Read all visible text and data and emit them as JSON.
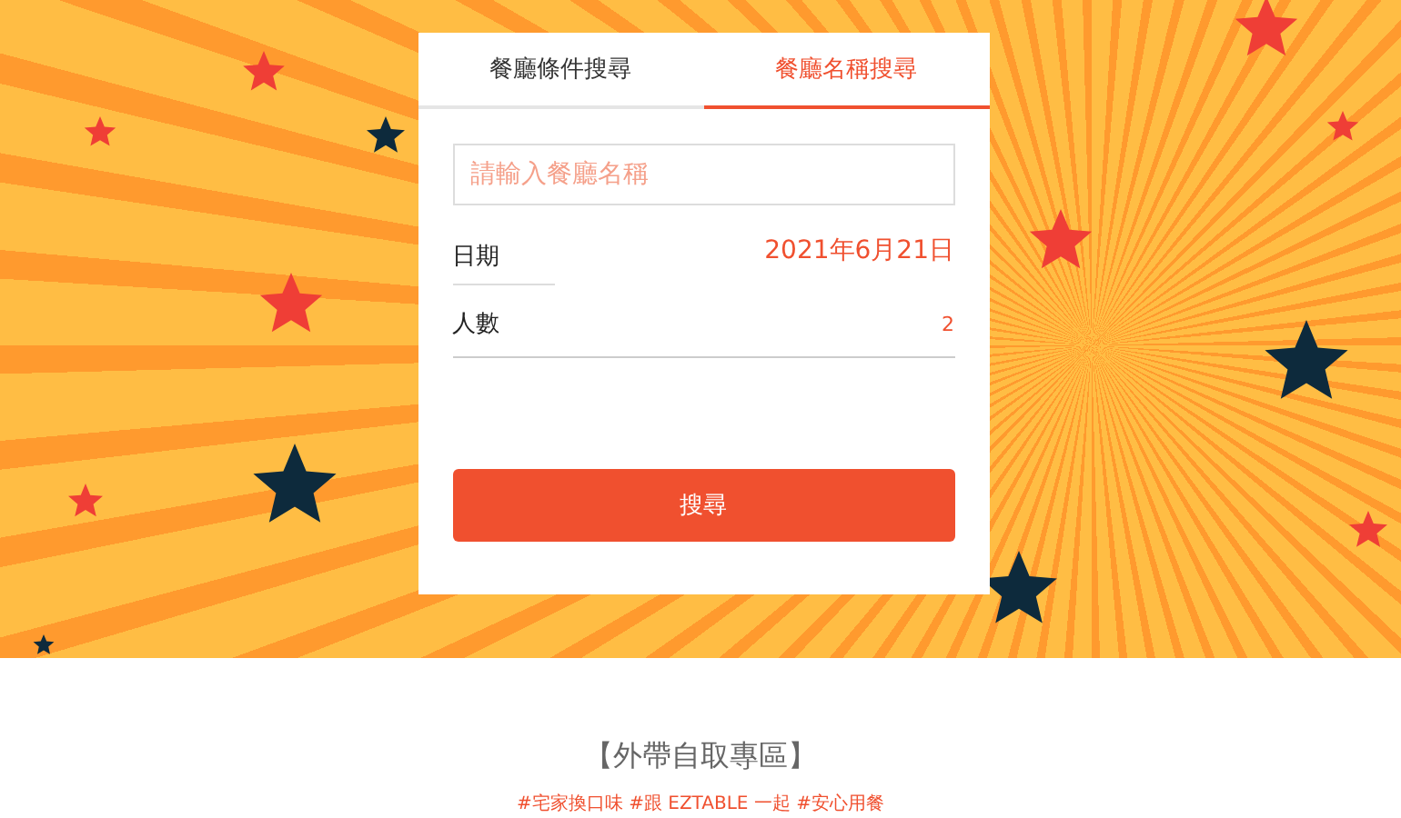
{
  "search_card": {
    "tabs": [
      {
        "label": "餐廳條件搜尋",
        "selected": false
      },
      {
        "label": "餐廳名稱搜尋",
        "selected": true
      }
    ],
    "name_field": {
      "placeholder": "請輸入餐廳名稱"
    },
    "date": {
      "label": "日期",
      "value": "2021年6月21日"
    },
    "party_size": {
      "label": "人數",
      "value": "2"
    },
    "search_button": "搜尋"
  },
  "section": {
    "title": "【外帶自取專區】",
    "tags": "#宅家換口味 #跟 EZTABLE 一起 #安心用餐"
  }
}
